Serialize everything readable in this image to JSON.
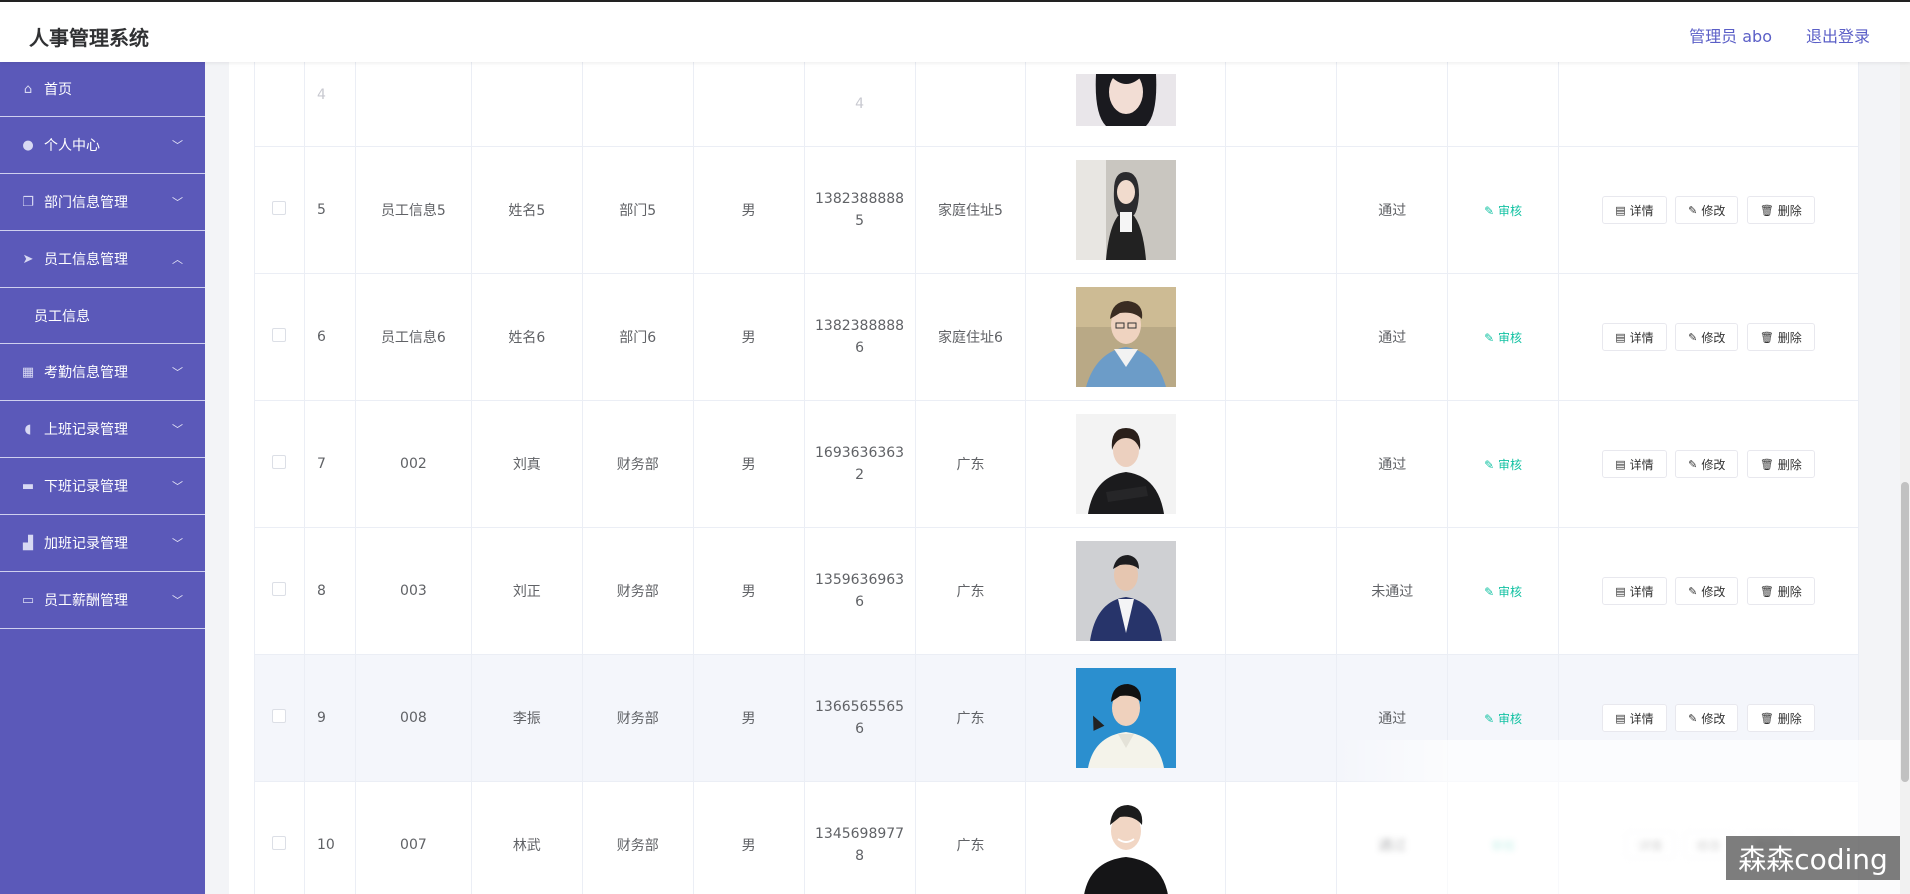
{
  "header": {
    "title": "人事管理系统",
    "user": "管理员 abo",
    "logout": "退出登录"
  },
  "sidebar": {
    "items": [
      {
        "label": "首页",
        "icon": "home-icon",
        "expandable": false
      },
      {
        "label": "个人中心",
        "icon": "user-icon",
        "expandable": true
      },
      {
        "label": "部门信息管理",
        "icon": "copy-icon",
        "expandable": true
      },
      {
        "label": "员工信息管理",
        "icon": "send-icon",
        "expandable": true,
        "expanded": true,
        "children": [
          "员工信息"
        ]
      },
      {
        "label": "考勤信息管理",
        "icon": "grid-icon",
        "expandable": true
      },
      {
        "label": "上班记录管理",
        "icon": "microphone-icon",
        "expandable": true
      },
      {
        "label": "下班记录管理",
        "icon": "monitor-icon",
        "expandable": true
      },
      {
        "label": "加班记录管理",
        "icon": "thumb-icon",
        "expandable": true
      },
      {
        "label": "员工薪酬管理",
        "icon": "briefcase-icon",
        "expandable": true
      }
    ]
  },
  "table": {
    "review_label": "审核",
    "ops": {
      "detail": "详情",
      "edit": "修改",
      "delete": "删除"
    },
    "partial_row": {
      "index": "4",
      "phone_tail": "4"
    },
    "rows": [
      {
        "index": "5",
        "info": "员工信息5",
        "name": "姓名5",
        "dept": "部门5",
        "gender": "男",
        "phone1": "1382388888",
        "phone2": "5",
        "address": "家庭住址5",
        "status": "通过",
        "photo": "woman-jacket"
      },
      {
        "index": "6",
        "info": "员工信息6",
        "name": "姓名6",
        "dept": "部门6",
        "gender": "男",
        "phone1": "1382388888",
        "phone2": "6",
        "address": "家庭住址6",
        "status": "通过",
        "photo": "man-denim"
      },
      {
        "index": "7",
        "info": "002",
        "name": "刘真",
        "dept": "财务部",
        "gender": "男",
        "phone1": "1693636363",
        "phone2": "2",
        "address": "广东",
        "status": "通过",
        "photo": "woman-suit"
      },
      {
        "index": "8",
        "info": "003",
        "name": "刘正",
        "dept": "财务部",
        "gender": "男",
        "phone1": "1359636963",
        "phone2": "6",
        "address": "广东",
        "status": "未通过",
        "photo": "man-blue-suit"
      },
      {
        "index": "9",
        "info": "008",
        "name": "李振",
        "dept": "财务部",
        "gender": "男",
        "phone1": "1366565565",
        "phone2": "6",
        "address": "广东",
        "status": "通过",
        "photo": "man-blue-bg"
      },
      {
        "index": "10",
        "info": "007",
        "name": "林武",
        "dept": "财务部",
        "gender": "男",
        "phone1": "1345698977",
        "phone2": "8",
        "address": "广东",
        "status": "",
        "photo": "man-white-bg"
      }
    ]
  },
  "watermark": "森森coding",
  "colors": {
    "sidebar": "#5b59b9",
    "accent": "#5b5fc7",
    "review": "#13c2a3"
  }
}
